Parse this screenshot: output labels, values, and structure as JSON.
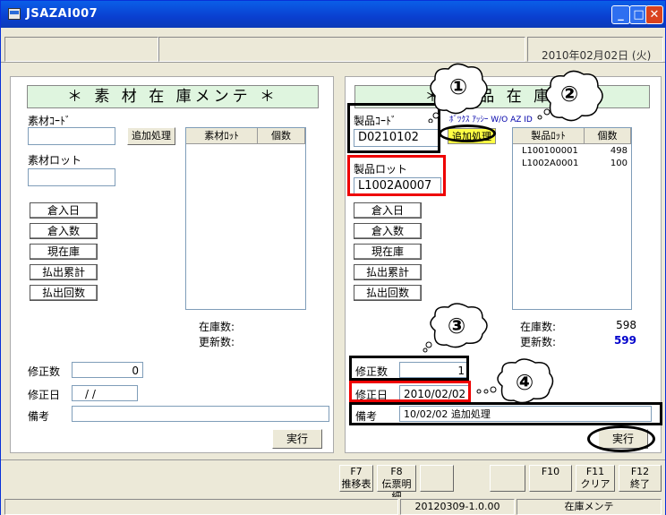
{
  "window": {
    "title": "JSAZAI007"
  },
  "header": {
    "date": "2010年02月02日 (火)"
  },
  "left": {
    "title": "＊ 素 材 在 庫メンテ ＊",
    "material_code_label": "素材ｺｰﾄﾞ",
    "add_button": "追加処理",
    "material_lot_label": "素材ロット",
    "list_headers": [
      "素材ﾛｯﾄ",
      "個数"
    ],
    "buttons": [
      "倉入日",
      "倉入数",
      "現在庫",
      "払出累計",
      "払出回数"
    ],
    "stock_label": "在庫数:",
    "update_label": "更新数:",
    "edit_count_label": "修正数",
    "edit_count_value": "0",
    "edit_date_label": "修正日",
    "edit_date_value": "/ /",
    "note_label": "備考",
    "exec_button": "実行"
  },
  "right": {
    "title": "＊ 製 品 在 庫 ＊",
    "product_code_label": "製品ｺｰﾄﾞ",
    "product_code_value": "D0210102",
    "add_button": "追加処理",
    "product_name": "ﾎﾞﾂｸｽ ｱｯｼｰ W/O AZ ID",
    "product_lot_label": "製品ロット",
    "product_lot_value": "L1002A0007",
    "list_headers": [
      "製品ﾛｯﾄ",
      "個数"
    ],
    "rows": [
      {
        "lot": "L100100001",
        "qty": "498"
      },
      {
        "lot": "L1002A0001",
        "qty": "100"
      }
    ],
    "buttons": [
      "倉入日",
      "倉入数",
      "現在庫",
      "払出累計",
      "払出回数"
    ],
    "stock_label": "在庫数:",
    "stock_value": "598",
    "update_label": "更新数:",
    "update_value": "599",
    "edit_count_label": "修正数",
    "edit_count_value": "1",
    "edit_date_label": "修正日",
    "edit_date_value": "2010/02/02",
    "note_label": "備考",
    "note_value": "10/02/02 追加処理",
    "exec_button": "実行"
  },
  "callouts": [
    "①",
    "②",
    "③",
    "④"
  ],
  "fkeys": [
    {
      "key": "F7",
      "label": "推移表"
    },
    {
      "key": "F8",
      "label": "伝票明細"
    },
    {
      "key": "F10",
      "label": ""
    },
    {
      "key": "F11",
      "label": "クリア"
    },
    {
      "key": "F12",
      "label": "終了"
    }
  ],
  "status": {
    "version": "20120309-1.0.00",
    "screen": "在庫メンテ"
  },
  "colors": {
    "update_value": "#0000cc",
    "highlight_button": "#ffff44",
    "header_bg": "#dff5df"
  }
}
